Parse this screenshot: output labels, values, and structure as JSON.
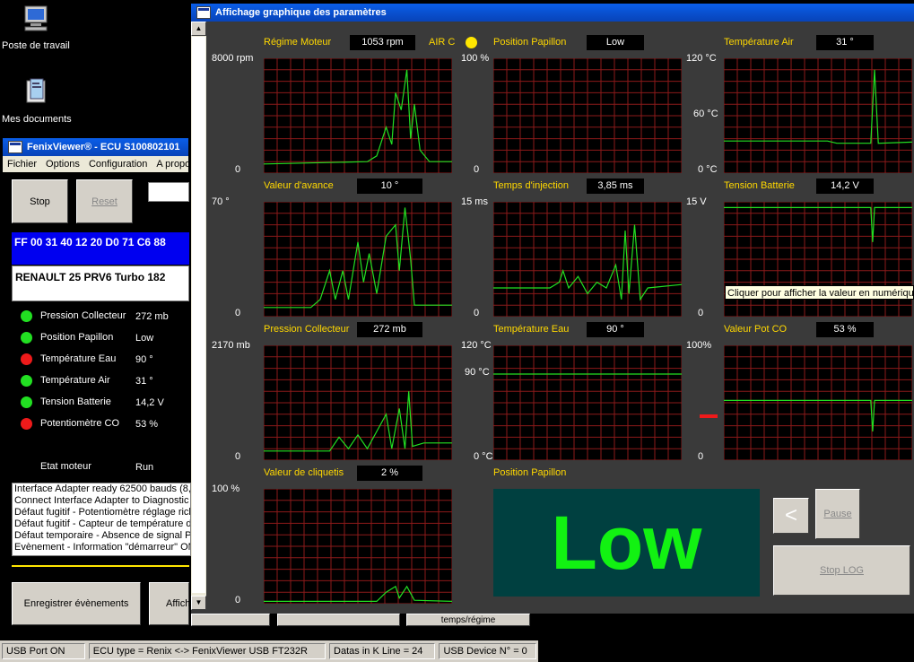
{
  "desktop": {
    "icons": [
      {
        "label": "Poste de travail"
      },
      {
        "label": "Mes documents"
      }
    ]
  },
  "fenix": {
    "title": "FenixViewer® - ECU S100802101",
    "menu": [
      "Fichier",
      "Options",
      "Configuration",
      "A propo"
    ],
    "stop_label": "Stop",
    "reset_label": "Reset",
    "hex": "FF 00 31 40 12 20 D0 71 C6 88",
    "vehicle": "RENAULT 25 PRV6 Turbo 182",
    "params": [
      {
        "label": "Pression Collecteur",
        "value": "272 mb",
        "color": "#22e022"
      },
      {
        "label": "Position Papillon",
        "value": "Low",
        "color": "#22e022"
      },
      {
        "label": "Température Eau",
        "value": "90 °",
        "color": "#ee1a1a"
      },
      {
        "label": "Température Air",
        "value": "31 °",
        "color": "#22e022"
      },
      {
        "label": "Tension Batterie",
        "value": "14,2 V",
        "color": "#22e022"
      },
      {
        "label": "Potentiomètre CO",
        "value": "53 %",
        "color": "#ee1a1a"
      }
    ],
    "engine_state_label": "Etat moteur",
    "engine_state_value": "Run",
    "log": [
      "Interface Adapter ready 62500 bauds (8,",
      "Connect Interface Adapter to Diagnostic",
      "Défaut fugitif - Potentiomètre réglage rich",
      "Défaut fugitif - Capteur de température d'",
      "Défaut temporaire - Absence de signal PM",
      "Evènement - Information \"démarreur\" ON"
    ],
    "btn_save_events": "Enregistrer évènements",
    "btn_display": "Affich",
    "btn_temps": "temps/régime"
  },
  "statusbar": [
    "USB Port ON",
    "ECU type = Renix <-> FenixViewer USB FT232R",
    "Datas in K Line = 24",
    "USB Device N° = 0"
  ],
  "graph_window": {
    "title": "Affichage graphique des paramètres",
    "air_c_label": "AIR C",
    "air_c_color": "#ffe600",
    "graphs": [
      {
        "label": "Régime Moteur",
        "value": "1053 rpm",
        "ymax": "8000 rpm",
        "ymid": "",
        "ymin": "0"
      },
      {
        "label": "Position Papillon",
        "value": "Low",
        "ymax": "100 %",
        "ymid": "",
        "ymin": "0"
      },
      {
        "label": "Température Air",
        "value": "31 °",
        "ymax": "120 °C",
        "ymid": "60 °C",
        "ymin": "0 °C"
      },
      {
        "label": "Valeur d'avance",
        "value": "10 °",
        "ymax": "70 °",
        "ymid": "",
        "ymin": "0"
      },
      {
        "label": "Temps d'injection",
        "value": "3,85 ms",
        "ymax": "15 ms",
        "ymid": "",
        "ymin": "0"
      },
      {
        "label": "Tension Batterie",
        "value": "14,2 V",
        "ymax": "15 V",
        "ymid": "",
        "ymin": "0"
      },
      {
        "label": "Pression Collecteur",
        "value": "272 mb",
        "ymax": "2170 mb",
        "ymid": "",
        "ymin": "0"
      },
      {
        "label": "Température Eau",
        "value": "90 °",
        "ymax": "120 °C",
        "ymid": "90 °C",
        "ymin": "0 °C"
      },
      {
        "label": "Valeur Pot CO",
        "value": "53 %",
        "ymax": "100%",
        "ymid": "",
        "ymin": "0"
      },
      {
        "label": "Valeur de cliquetis",
        "value": "2 %",
        "ymax": "100 %",
        "ymid": "",
        "ymin": "0"
      }
    ],
    "position_panel_label": "Position Papillon",
    "big_value": "Low",
    "tooltip": "Cliquer pour afficher la valeur en numérique",
    "back_label": "<",
    "pause_label": "Pause",
    "stop_log_label": "Stop LOG",
    "trace_color": "#22e022",
    "grid_color": "#8b1a1a"
  }
}
